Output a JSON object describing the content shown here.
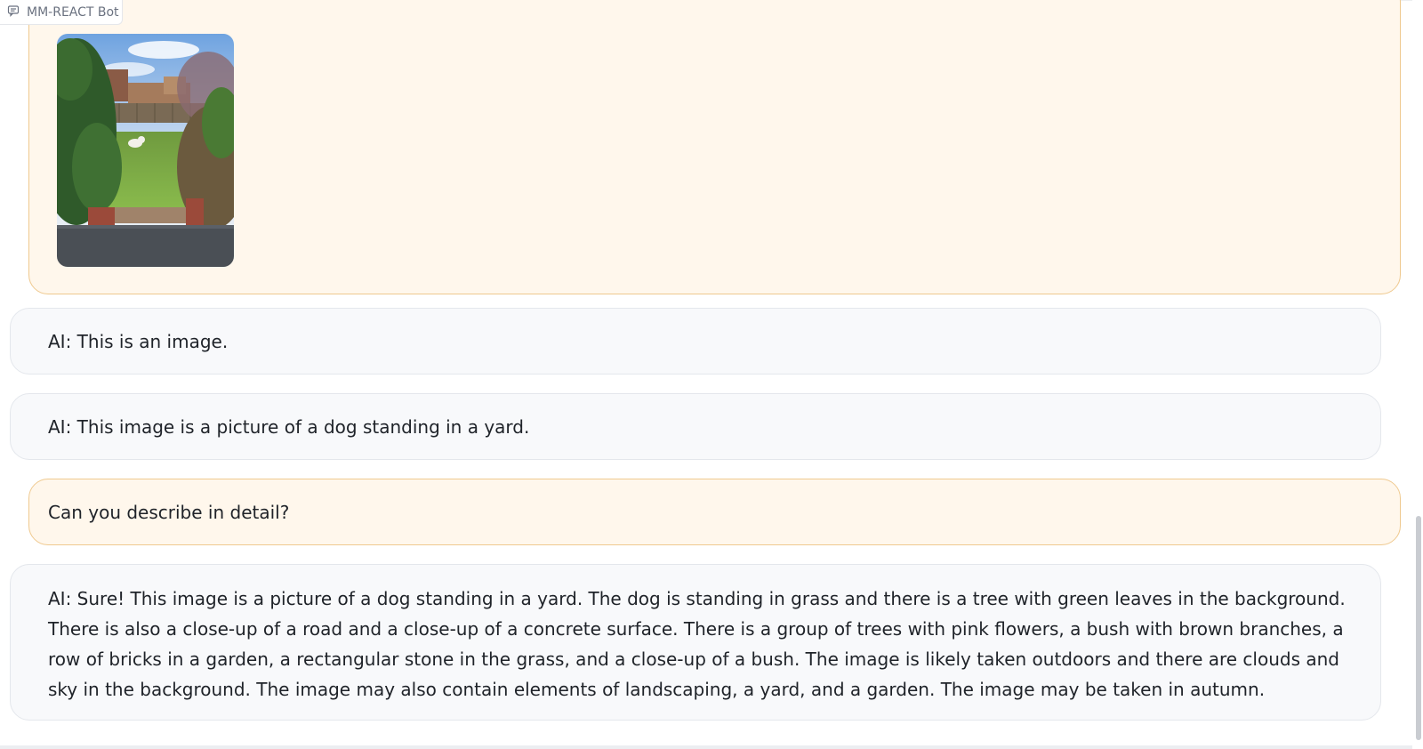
{
  "header": {
    "label": "MM-REACT Bot",
    "icon": "chat-icon"
  },
  "messages": [
    {
      "role": "user",
      "type": "image",
      "alt": "garden-dog-photo"
    },
    {
      "role": "bot",
      "text": "AI: This is an image."
    },
    {
      "role": "bot",
      "text": "AI: This image is a picture of a dog standing in a yard."
    },
    {
      "role": "user",
      "text": "Can you describe in detail?"
    },
    {
      "role": "bot",
      "text": "AI: Sure! This image is a picture of a dog standing in a yard. The dog is standing in grass and there is a tree with green leaves in the background. There is also a close-up of a road and a close-up of a concrete surface. There is a group of trees with pink flowers, a bush with brown branches, a row of bricks in a garden, a rectangular stone in the grass, and a close-up of a bush. The image is likely taken outdoors and there are clouds and sky in the background. The image may also contain elements of landscaping, a yard, and a garden. The image may be taken in autumn."
    }
  ],
  "colors": {
    "user_bubble_bg": "#fff7ec",
    "user_bubble_border": "#efc98f",
    "bot_bubble_bg": "#f8f9fb",
    "bot_bubble_border": "#e4e7ec"
  }
}
